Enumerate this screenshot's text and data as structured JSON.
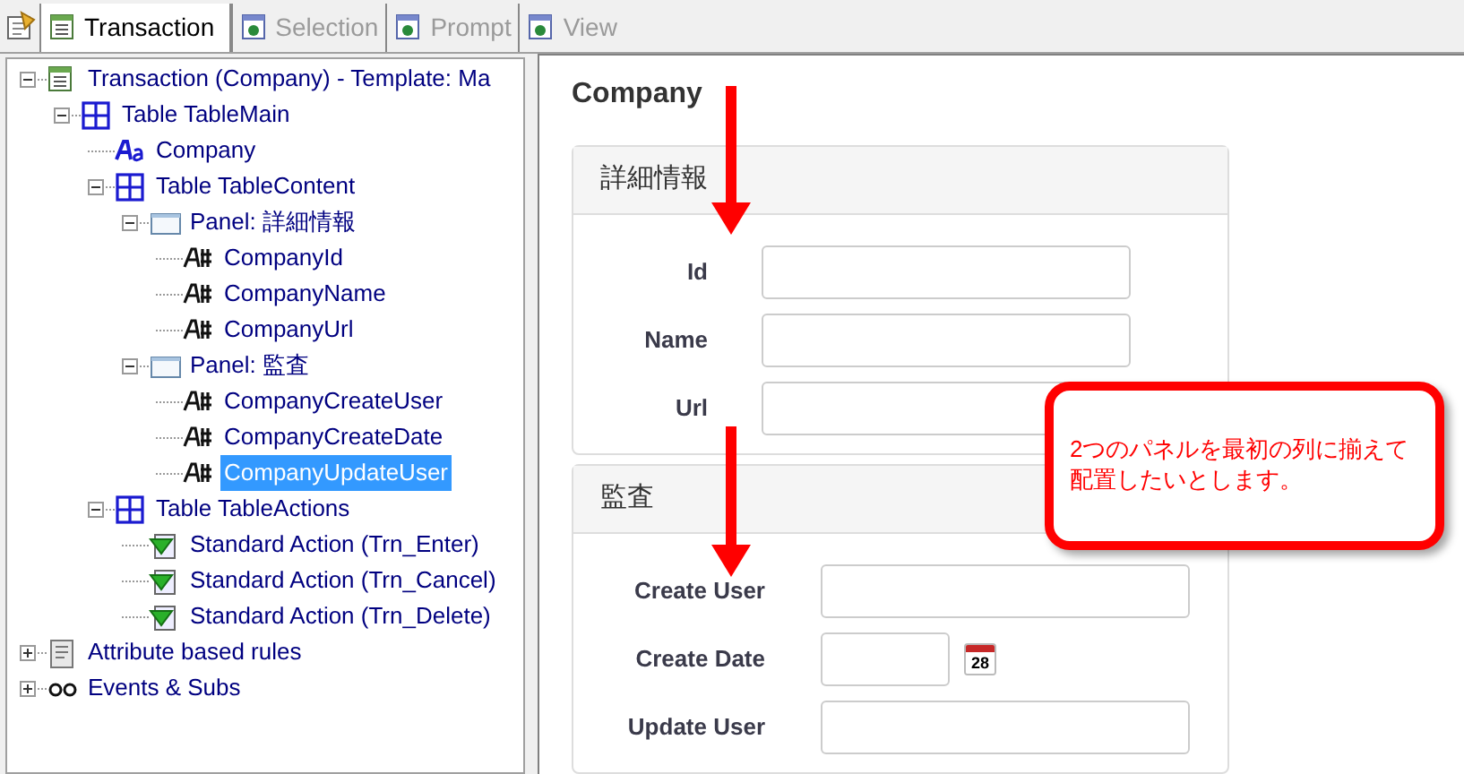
{
  "tabs": [
    {
      "label": "Transaction",
      "selected": true,
      "kind": "transaction"
    },
    {
      "label": "Selection",
      "selected": false,
      "kind": "webform"
    },
    {
      "label": "Prompt",
      "selected": false,
      "kind": "webform"
    },
    {
      "label": "View",
      "selected": false,
      "kind": "webform"
    }
  ],
  "tree": [
    {
      "label": "Transaction (Company) - Template: Ma",
      "kind": "transaction",
      "expanded": true,
      "selected": false,
      "children": [
        {
          "label": "Table TableMain",
          "kind": "table",
          "expanded": true,
          "selected": false,
          "children": [
            {
              "label": "Company",
              "kind": "textblock",
              "selected": false
            },
            {
              "label": "Table TableContent",
              "kind": "table",
              "expanded": true,
              "selected": false,
              "children": [
                {
                  "label": "Panel: 詳細情報",
                  "kind": "panel",
                  "expanded": true,
                  "selected": false,
                  "children": [
                    {
                      "label": "CompanyId",
                      "kind": "attribute",
                      "selected": false
                    },
                    {
                      "label": "CompanyName",
                      "kind": "attribute",
                      "selected": false
                    },
                    {
                      "label": "CompanyUrl",
                      "kind": "attribute",
                      "selected": false
                    }
                  ]
                },
                {
                  "label": "Panel: 監査",
                  "kind": "panel",
                  "expanded": true,
                  "selected": false,
                  "children": [
                    {
                      "label": "CompanyCreateUser",
                      "kind": "attribute",
                      "selected": false
                    },
                    {
                      "label": "CompanyCreateDate",
                      "kind": "attribute",
                      "selected": false
                    },
                    {
                      "label": "CompanyUpdateUser",
                      "kind": "attribute",
                      "selected": true
                    }
                  ]
                }
              ]
            },
            {
              "label": "Table TableActions",
              "kind": "table",
              "expanded": true,
              "selected": false,
              "children": [
                {
                  "label": "Standard Action (Trn_Enter)",
                  "kind": "action",
                  "selected": false
                },
                {
                  "label": "Standard Action (Trn_Cancel)",
                  "kind": "action",
                  "selected": false
                },
                {
                  "label": "Standard Action (Trn_Delete)",
                  "kind": "action",
                  "selected": false
                }
              ]
            }
          ]
        }
      ]
    },
    {
      "label": "Attribute based rules",
      "kind": "rules",
      "expanded": false,
      "selected": false
    },
    {
      "label": "Events & Subs",
      "kind": "events",
      "expanded": false,
      "selected": false
    }
  ],
  "form": {
    "title": "Company",
    "panels": [
      {
        "title": "詳細情報",
        "fields": [
          {
            "label": "Id",
            "kind": "text"
          },
          {
            "label": "Name",
            "kind": "text"
          },
          {
            "label": "Url",
            "kind": "text"
          }
        ]
      },
      {
        "title": "監査",
        "fields": [
          {
            "label": "Create User",
            "kind": "text"
          },
          {
            "label": "Create Date",
            "kind": "date",
            "icon_text": "28"
          },
          {
            "label": "Update User",
            "kind": "text"
          }
        ]
      }
    ]
  },
  "callout": {
    "text": "2つのパネルを最初の列に揃えて配置したいとします。"
  }
}
